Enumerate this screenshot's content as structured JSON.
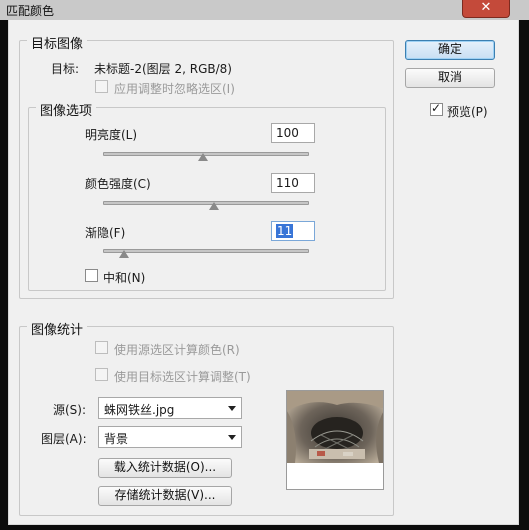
{
  "window": {
    "title": "匹配颜色"
  },
  "target": {
    "legend": "目标图像",
    "target_label": "目标:",
    "target_value": "未标题-2(图层 2, RGB/8)",
    "ignore_selection": "应用调整时忽略选区(I)"
  },
  "options": {
    "legend": "图像选项",
    "luminance": {
      "label": "明亮度(L)",
      "value": "100",
      "slider_fraction": 0.5
    },
    "intensity": {
      "label": "颜色强度(C)",
      "value": "110",
      "slider_fraction": 0.55
    },
    "fade": {
      "label": "渐隐(F)",
      "value": "11",
      "slider_fraction": 0.11
    },
    "neutralize": "中和(N)"
  },
  "stats": {
    "legend": "图像统计",
    "use_source_selection": "使用源选区计算颜色(R)",
    "use_target_selection": "使用目标选区计算调整(T)",
    "source_label": "源(S):",
    "source_value": "蛛网铁丝.jpg",
    "layer_label": "图层(A):",
    "layer_value": "背景",
    "load_button": "载入统计数据(O)...",
    "save_button": "存储统计数据(V)..."
  },
  "buttons": {
    "ok": "确定",
    "cancel": "取消"
  },
  "preview_checkbox": {
    "label": "预览(P)",
    "checked": true
  },
  "colors": {
    "accent": "#3875d7",
    "default_button": "#c8dff3",
    "close": "#c44a3a"
  }
}
